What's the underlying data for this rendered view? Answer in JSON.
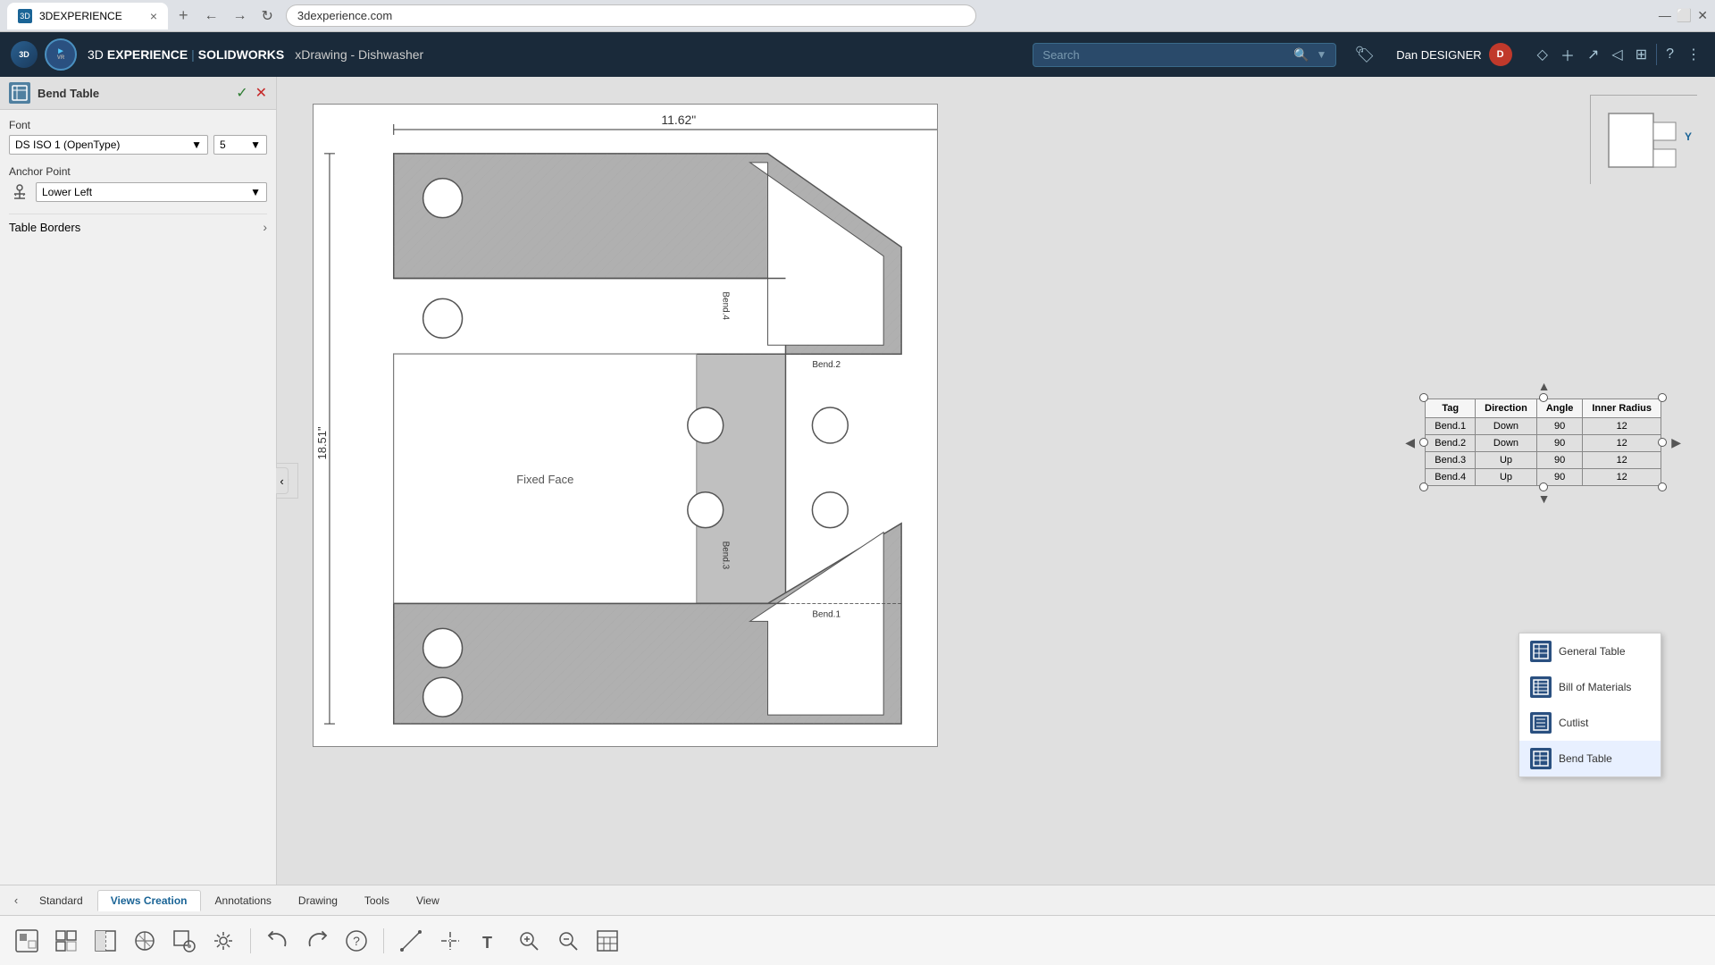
{
  "browser": {
    "tab_title": "3DEXPERIENCE",
    "tab_close": "×",
    "tab_add": "+",
    "nav_back": "←",
    "nav_forward": "→",
    "nav_refresh": "↻",
    "address": "3dexperience.com"
  },
  "header": {
    "app_name_prefix": "3D",
    "app_name_bold": "EXPERIENCE",
    "separator": "|",
    "app_suite": "SOLIDWORKS",
    "doc_title": "xDrawing - Dishwasher",
    "search_placeholder": "Search",
    "user_name": "Dan DESIGNER",
    "user_initials": "D"
  },
  "panel": {
    "title": "Bend Table",
    "ok_label": "✓",
    "close_label": "✕",
    "font_label": "Font",
    "font_family": "DS ISO 1 (OpenType)",
    "font_size": "5",
    "anchor_label": "Anchor Point",
    "anchor_value": "Lower Left",
    "table_borders_label": "Table Borders"
  },
  "bend_table": {
    "headers": [
      "Tag",
      "Direction",
      "Angle",
      "Inner Radius"
    ],
    "rows": [
      {
        "tag": "Bend.1",
        "direction": "Down",
        "angle": "90",
        "inner_radius": "12"
      },
      {
        "tag": "Bend.2",
        "direction": "Down",
        "angle": "90",
        "inner_radius": "12"
      },
      {
        "tag": "Bend.3",
        "direction": "Up",
        "angle": "90",
        "inner_radius": "12"
      },
      {
        "tag": "Bend.4",
        "direction": "Up",
        "angle": "90",
        "inner_radius": "12"
      }
    ]
  },
  "drawing": {
    "width_dim": "11.62\"",
    "height_dim": "18.51\"",
    "fixed_face_label": "Fixed Face",
    "bend1_label": "Bend.1",
    "bend2_label": "Bend.2",
    "bend3_label": "Bend.3",
    "bend4_label": "Bend.4"
  },
  "context_menu": {
    "items": [
      {
        "label": "General Table",
        "icon": "table"
      },
      {
        "label": "Bill of Materials",
        "icon": "bom"
      },
      {
        "label": "Cutlist",
        "icon": "cutlist"
      },
      {
        "label": "Bend Table",
        "icon": "bend",
        "active": true
      }
    ]
  },
  "toolbar": {
    "tabs": [
      "Standard",
      "Views Creation",
      "Annotations",
      "Drawing",
      "Tools",
      "View"
    ],
    "active_tab": "Views Creation",
    "tools": [
      "⊞",
      "⊡",
      "⬚",
      "↻",
      "⊟",
      "⚙",
      "↩",
      "↪",
      "?",
      "✏",
      "⌀",
      "T",
      "⊕",
      "⊖",
      "⊞"
    ]
  }
}
